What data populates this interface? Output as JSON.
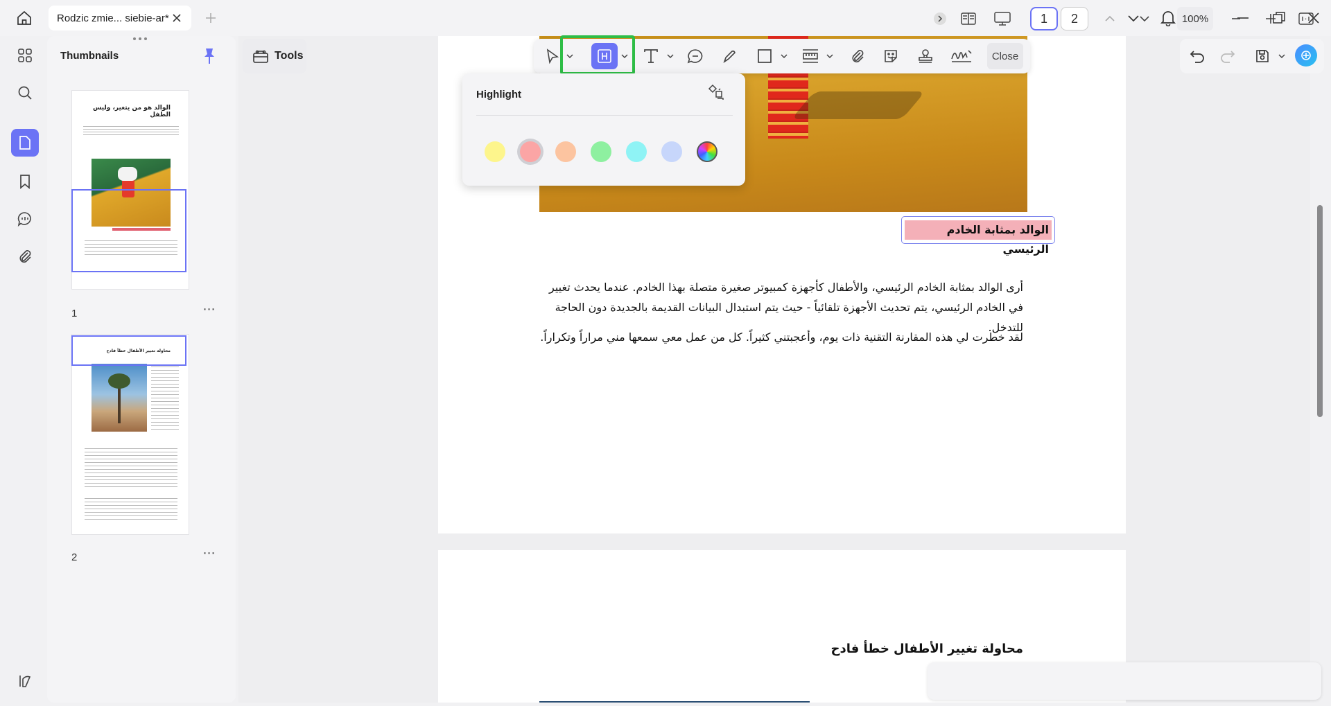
{
  "titlebar": {
    "tab_title": "Rodzic zmie... siebie-ar*"
  },
  "thumbnails": {
    "title": "Thumbnails",
    "pages": [
      {
        "number": "1",
        "heading": "الوالد هو من يتغير، وليس الطفل"
      },
      {
        "number": "2",
        "heading": "محاولة تغيير الأطفال خطأ فادح"
      }
    ]
  },
  "tools": {
    "label": "Tools"
  },
  "toolbar": {
    "close_label": "Close"
  },
  "highlight_popup": {
    "title": "Highlight",
    "colors": [
      "#fdf58c",
      "#fba5a5",
      "#fcc4a0",
      "#8ef0a0",
      "#8ff3f5",
      "#c7d6fb",
      "rainbow"
    ],
    "selected_index": 1
  },
  "document": {
    "page1": {
      "highlighted_heading": "الوالد بمثابة الخادم الرئيسي",
      "para1_line1": "أرى الوالد بمثابة الخادم الرئيسي، والأطفال كأجهزة كمبيوتر صغيرة متصلة بهذا الخادم. عندما يحدث تغيير",
      "para1_line2": "في الخادم الرئيسي، يتم تحديث الأجهزة تلقائياً - حيث يتم استبدال البيانات القديمة بالجديدة دون الحاجة للتدخل.",
      "para2": "لقد خطرت لي هذه المقارنة التقنية ذات يوم، وأعجبتني كثيراً. كل من عمل معي سمعها مني مراراً وتكراراً."
    },
    "page2": {
      "heading": "محاولة تغيير الأطفال خطأ فادح"
    }
  },
  "bottombar": {
    "page_1": "1",
    "page_2": "2",
    "zoom": "100%"
  }
}
